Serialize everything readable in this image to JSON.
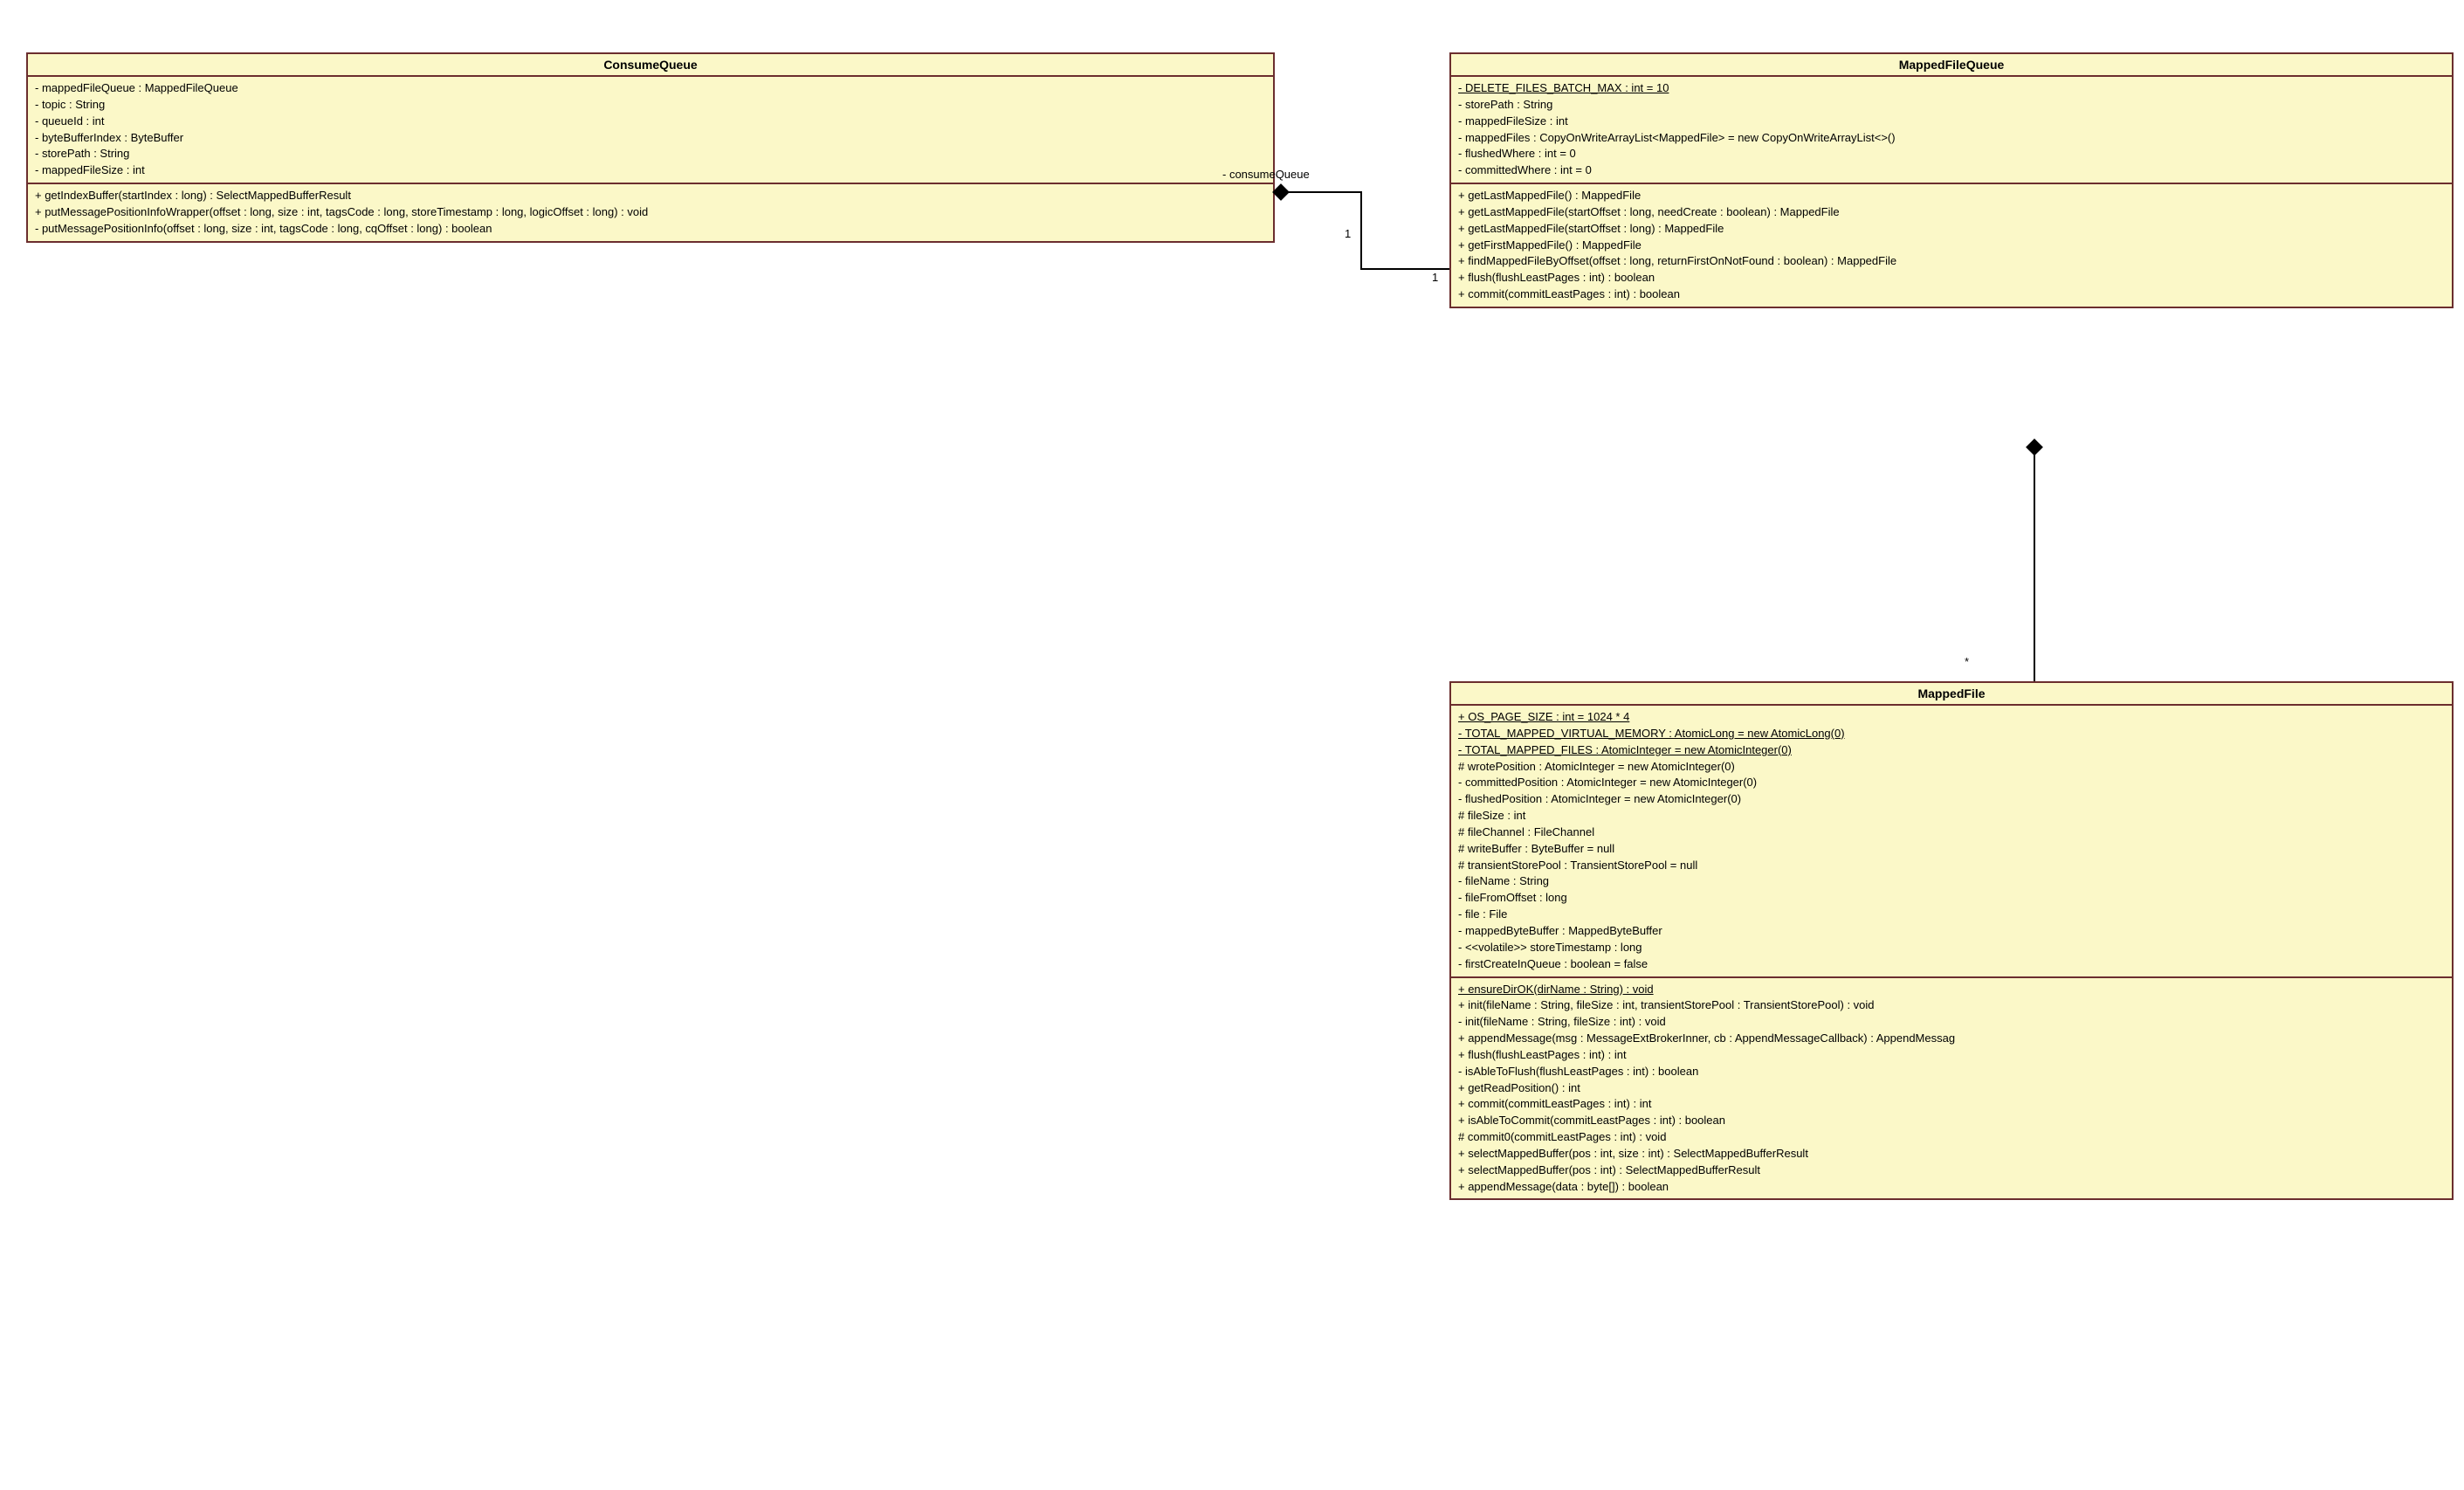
{
  "classes": {
    "consumeQueue": {
      "name": "ConsumeQueue",
      "attributes": [
        {
          "text": "- mappedFileQueue : MappedFileQueue"
        },
        {
          "text": "- topic : String"
        },
        {
          "text": "- queueId : int"
        },
        {
          "text": "- byteBufferIndex : ByteBuffer"
        },
        {
          "text": "- storePath : String"
        },
        {
          "text": "- mappedFileSize : int"
        }
      ],
      "operations": [
        {
          "text": "+ getIndexBuffer(startIndex : long) : SelectMappedBufferResult"
        },
        {
          "text": "+ putMessagePositionInfoWrapper(offset : long, size : int, tagsCode : long, storeTimestamp : long, logicOffset : long) : void"
        },
        {
          "text": "- putMessagePositionInfo(offset : long, size : int, tagsCode : long, cqOffset : long) : boolean"
        }
      ]
    },
    "mappedFileQueue": {
      "name": "MappedFileQueue",
      "attributes": [
        {
          "text": "- DELETE_FILES_BATCH_MAX : int = 10",
          "static": true
        },
        {
          "text": "- storePath : String"
        },
        {
          "text": "- mappedFileSize : int"
        },
        {
          "text": "- mappedFiles : CopyOnWriteArrayList<MappedFile> = new CopyOnWriteArrayList<>()"
        },
        {
          "text": "- flushedWhere : int = 0"
        },
        {
          "text": "- committedWhere : int = 0"
        }
      ],
      "operations": [
        {
          "text": "+ getLastMappedFile() : MappedFile"
        },
        {
          "text": "+ getLastMappedFile(startOffset : long, needCreate : boolean) : MappedFile"
        },
        {
          "text": "+ getLastMappedFile(startOffset : long) : MappedFile"
        },
        {
          "text": "+ getFirstMappedFile() : MappedFile"
        },
        {
          "text": "+ findMappedFileByOffset(offset : long, returnFirstOnNotFound : boolean) : MappedFile"
        },
        {
          "text": "+ flush(flushLeastPages : int) : boolean"
        },
        {
          "text": "+ commit(commitLeastPages : int) : boolean"
        }
      ]
    },
    "mappedFile": {
      "name": "MappedFile",
      "attributes": [
        {
          "text": "+ OS_PAGE_SIZE : int = 1024 * 4",
          "static": true
        },
        {
          "text": "- TOTAL_MAPPED_VIRTUAL_MEMORY : AtomicLong = new AtomicLong(0)",
          "static": true
        },
        {
          "text": "- TOTAL_MAPPED_FILES : AtomicInteger = new AtomicInteger(0)",
          "static": true
        },
        {
          "text": "# wrotePosition : AtomicInteger = new AtomicInteger(0)"
        },
        {
          "text": "- committedPosition : AtomicInteger = new AtomicInteger(0)"
        },
        {
          "text": "- flushedPosition : AtomicInteger = new AtomicInteger(0)"
        },
        {
          "text": "# fileSize : int"
        },
        {
          "text": "# fileChannel : FileChannel"
        },
        {
          "text": "# writeBuffer : ByteBuffer = null"
        },
        {
          "text": "# transientStorePool : TransientStorePool = null"
        },
        {
          "text": "- fileName : String"
        },
        {
          "text": "- fileFromOffset : long"
        },
        {
          "text": "- file : File"
        },
        {
          "text": "- mappedByteBuffer : MappedByteBuffer"
        },
        {
          "text": "- <<volatile>> storeTimestamp : long"
        },
        {
          "text": "- firstCreateInQueue : boolean = false"
        }
      ],
      "operations": [
        {
          "text": "+ ensureDirOK(dirName : String) : void",
          "static": true
        },
        {
          "text": "+ init(fileName : String, fileSize : int, transientStorePool : TransientStorePool) : void"
        },
        {
          "text": "- init(fileName : String, fileSize : int) : void"
        },
        {
          "text": "+ appendMessage(msg : MessageExtBrokerInner, cb : AppendMessageCallback) : AppendMessag"
        },
        {
          "text": "+ flush(flushLeastPages : int) : int"
        },
        {
          "text": "- isAbleToFlush(flushLeastPages : int) : boolean"
        },
        {
          "text": "+ getReadPosition() : int"
        },
        {
          "text": "+ commit(commitLeastPages : int) : int"
        },
        {
          "text": "+ isAbleToCommit(commitLeastPages : int) : boolean"
        },
        {
          "text": "# commit0(commitLeastPages : int) : void"
        },
        {
          "text": "+ selectMappedBuffer(pos : int, size : int) : SelectMappedBufferResult"
        },
        {
          "text": "+ selectMappedBuffer(pos : int) : SelectMappedBufferResult"
        },
        {
          "text": "+ appendMessage(data : byte[]) : boolean"
        }
      ]
    }
  },
  "associations": {
    "cq_to_mfq": {
      "label": "- consumeQueue",
      "mult_left": "1",
      "mult_right": "1"
    },
    "mfq_to_mf": {
      "mult_parent": "",
      "mult_child": "*"
    }
  }
}
